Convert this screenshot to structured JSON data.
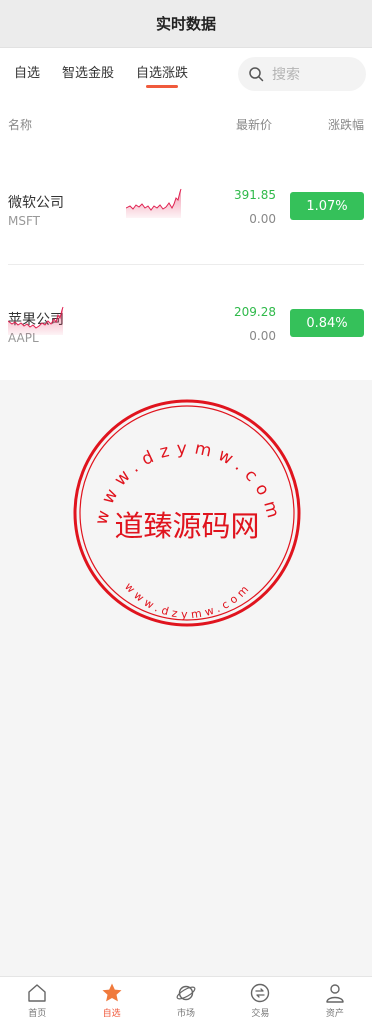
{
  "header": {
    "title": "实时数据"
  },
  "tabs": [
    {
      "label": "自选",
      "active": false
    },
    {
      "label": "智选金股",
      "active": false
    },
    {
      "label": "自选涨跌",
      "active": true
    }
  ],
  "search": {
    "placeholder": "搜索"
  },
  "table": {
    "headers": {
      "name": "名称",
      "price": "最新价",
      "change": "涨跌幅"
    },
    "rows": [
      {
        "name": "微软公司",
        "code": "MSFT",
        "price": "391.85",
        "change": "0.00",
        "percent": "1.07%"
      },
      {
        "name": "苹果公司",
        "code": "AAPL",
        "price": "209.28",
        "change": "0.00",
        "percent": "0.84%"
      }
    ]
  },
  "watermark": {
    "center_text": "道臻源码网",
    "ring_text": "www.dzymw.com"
  },
  "bottom_nav": [
    {
      "label": "首页",
      "icon": "home-icon",
      "active": false
    },
    {
      "label": "自选",
      "icon": "star-icon",
      "active": true
    },
    {
      "label": "市场",
      "icon": "planet-icon",
      "active": false
    },
    {
      "label": "交易",
      "icon": "trade-icon",
      "active": false
    },
    {
      "label": "资产",
      "icon": "user-icon",
      "active": false
    }
  ],
  "colors": {
    "accent": "#f05a3c",
    "up_green": "#35c15a",
    "stamp_red": "#e0141e",
    "spark_red": "#e02050"
  }
}
